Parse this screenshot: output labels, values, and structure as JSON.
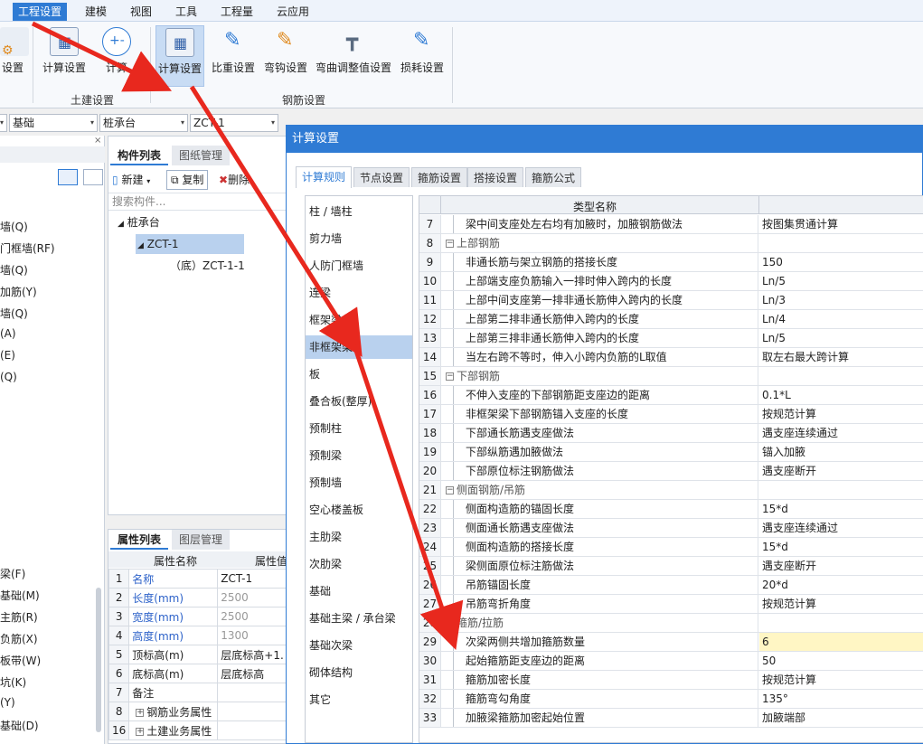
{
  "menu": [
    "工程设置",
    "建模",
    "视图",
    "工具",
    "工程量",
    "云应用"
  ],
  "ribbon": {
    "buttons": [
      "设置",
      "计算设置",
      "计算",
      "计算设置",
      "比重设置",
      "弯钩设置",
      "弯曲调整值设置",
      "损耗设置"
    ],
    "groups": [
      "土建设置",
      "钢筋设置"
    ]
  },
  "combos": [
    "基础",
    "桩承台",
    "ZCT-1"
  ],
  "left_items": [
    "墙(Q)",
    "门框墙(RF)",
    "墙(Q)",
    "加筋(Y)",
    "墙(Q)",
    "(A)",
    "(E)",
    "(Q)",
    "梁(F)",
    "基础(M)",
    "主筋(R)",
    "负筋(X)",
    "板带(W)",
    "坑(K)",
    "(Y)",
    "基础(D)"
  ],
  "comp_panel": {
    "tabs": [
      "构件列表",
      "图纸管理"
    ],
    "toolbar": {
      "new": "新建",
      "copy": "复制",
      "delete": "删除"
    },
    "search_placeholder": "搜索构件...",
    "tree": [
      "桩承台",
      "ZCT-1",
      "（底）ZCT-1-1"
    ]
  },
  "prop_panel": {
    "tabs": [
      "属性列表",
      "图层管理"
    ],
    "headers": [
      "属性名称",
      "属性值"
    ],
    "rows": [
      {
        "n": "1",
        "k": "名称",
        "v": "ZCT-1"
      },
      {
        "n": "2",
        "k": "长度(mm)",
        "v": "2500"
      },
      {
        "n": "3",
        "k": "宽度(mm)",
        "v": "2500"
      },
      {
        "n": "4",
        "k": "高度(mm)",
        "v": "1300"
      },
      {
        "n": "5",
        "k": "顶标高(m)",
        "v": "层底标高+1."
      },
      {
        "n": "6",
        "k": "底标高(m)",
        "v": "层底标高"
      },
      {
        "n": "7",
        "k": "备注",
        "v": ""
      },
      {
        "n": "8",
        "k": "钢筋业务属性",
        "v": ""
      },
      {
        "n": "16",
        "k": "土建业务属性",
        "v": ""
      }
    ]
  },
  "dialog": {
    "title": "计算设置",
    "tabs": [
      "计算规则",
      "节点设置",
      "箍筋设置",
      "搭接设置",
      "箍筋公式"
    ],
    "categories": [
      "柱 / 墙柱",
      "剪力墙",
      "人防门框墙",
      "连梁",
      "框架梁",
      "非框架梁",
      "板",
      "叠合板(整厚)",
      "预制柱",
      "预制梁",
      "预制墙",
      "空心楼盖板",
      "主肋梁",
      "次肋梁",
      "基础",
      "基础主梁 / 承台梁",
      "基础次梁",
      "砌体结构",
      "其它"
    ],
    "grid_header": "类型名称",
    "rows": [
      {
        "n": "7",
        "name": "梁中间支座处左右均有加腋时，加腋钢筋做法",
        "val": "按图集贯通计算",
        "group": false
      },
      {
        "n": "8",
        "name": "上部钢筋",
        "val": "",
        "group": true
      },
      {
        "n": "9",
        "name": "非通长筋与架立钢筋的搭接长度",
        "val": "150",
        "group": false
      },
      {
        "n": "10",
        "name": "上部端支座负筋输入一排时伸入跨内的长度",
        "val": "Ln/5",
        "group": false
      },
      {
        "n": "11",
        "name": "上部中间支座第一排非通长筋伸入跨内的长度",
        "val": "Ln/3",
        "group": false
      },
      {
        "n": "12",
        "name": "上部第二排非通长筋伸入跨内的长度",
        "val": "Ln/4",
        "group": false
      },
      {
        "n": "13",
        "name": "上部第三排非通长筋伸入跨内的长度",
        "val": "Ln/5",
        "group": false
      },
      {
        "n": "14",
        "name": "当左右跨不等时，伸入小跨内负筋的L取值",
        "val": "取左右最大跨计算",
        "group": false
      },
      {
        "n": "15",
        "name": "下部钢筋",
        "val": "",
        "group": true
      },
      {
        "n": "16",
        "name": "不伸入支座的下部钢筋距支座边的距离",
        "val": "0.1*L",
        "group": false
      },
      {
        "n": "17",
        "name": "非框架梁下部钢筋锚入支座的长度",
        "val": "按规范计算",
        "group": false
      },
      {
        "n": "18",
        "name": "下部通长筋遇支座做法",
        "val": "遇支座连续通过",
        "group": false
      },
      {
        "n": "19",
        "name": "下部纵筋遇加腋做法",
        "val": "锚入加腋",
        "group": false
      },
      {
        "n": "20",
        "name": "下部原位标注钢筋做法",
        "val": "遇支座断开",
        "group": false
      },
      {
        "n": "21",
        "name": "侧面钢筋/吊筋",
        "val": "",
        "group": true
      },
      {
        "n": "22",
        "name": "侧面构造筋的锚固长度",
        "val": "15*d",
        "group": false
      },
      {
        "n": "23",
        "name": "侧面通长筋遇支座做法",
        "val": "遇支座连续通过",
        "group": false
      },
      {
        "n": "24",
        "name": "侧面构造筋的搭接长度",
        "val": "15*d",
        "group": false
      },
      {
        "n": "25",
        "name": "梁侧面原位标注筋做法",
        "val": "遇支座断开",
        "group": false
      },
      {
        "n": "26",
        "name": "吊筋锚固长度",
        "val": "20*d",
        "group": false
      },
      {
        "n": "27",
        "name": "吊筋弯折角度",
        "val": "按规范计算",
        "group": false
      },
      {
        "n": "28",
        "name": "箍筋/拉筋",
        "val": "",
        "group": true
      },
      {
        "n": "29",
        "name": "次梁两侧共增加箍筋数量",
        "val": "6",
        "group": false
      },
      {
        "n": "30",
        "name": "起始箍筋距支座边的距离",
        "val": "50",
        "group": false
      },
      {
        "n": "31",
        "name": "箍筋加密长度",
        "val": "按规范计算",
        "group": false
      },
      {
        "n": "32",
        "name": "箍筋弯勾角度",
        "val": "135°",
        "group": false
      },
      {
        "n": "33",
        "name": "加腋梁箍筋加密起始位置",
        "val": "加腋端部",
        "group": false
      }
    ]
  },
  "colors": {
    "accent": "#2f7bd4",
    "arrow": "#e8281e",
    "highlight": "#fff6c4"
  }
}
